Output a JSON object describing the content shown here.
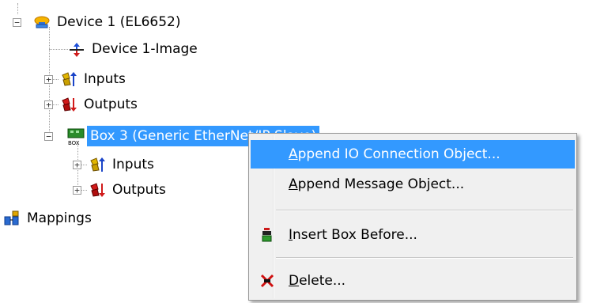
{
  "tree": {
    "device": {
      "label": "Device 1 (EL6652)",
      "icon": "device-icon"
    },
    "device_image": {
      "label": "Device 1-Image",
      "icon": "image-icon"
    },
    "inputs": {
      "label": "Inputs",
      "icon": "inputs-icon"
    },
    "outputs": {
      "label": "Outputs",
      "icon": "outputs-icon"
    },
    "box": {
      "label": "Box 3 (Generic EtherNet/IP Slave)",
      "icon": "box-icon"
    },
    "box_inputs": {
      "label": "Inputs",
      "icon": "inputs-icon"
    },
    "box_outputs": {
      "label": "Outputs",
      "icon": "outputs-icon"
    },
    "mappings": {
      "label": "Mappings",
      "icon": "mappings-icon"
    },
    "expander_plus": "+",
    "expander_minus": "−"
  },
  "context_menu": {
    "items": [
      {
        "prefix": "",
        "accel": "A",
        "rest": "ppend IO Connection Object...",
        "highlighted": true
      },
      {
        "prefix": "",
        "accel": "A",
        "rest": "ppend Message Object...",
        "highlighted": false
      },
      {
        "prefix": "",
        "accel": "I",
        "rest": "nsert Box Before...",
        "icon": "insert-box-icon",
        "highlighted": false
      },
      {
        "prefix": "",
        "accel": "D",
        "rest": "elete...",
        "icon": "delete-icon",
        "highlighted": false
      }
    ]
  },
  "colors": {
    "selection": "#3399ff",
    "menu_bg": "#f0f0f0"
  }
}
